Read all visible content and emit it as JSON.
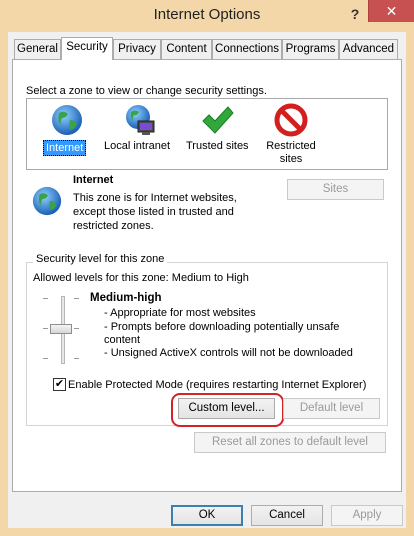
{
  "window": {
    "title": "Internet Options",
    "help_label": "?",
    "close_label": "✕"
  },
  "tabs": [
    "General",
    "Security",
    "Privacy",
    "Content",
    "Connections",
    "Programs",
    "Advanced"
  ],
  "active_tab": "Security",
  "zones_prompt": "Select a zone to view or change security settings.",
  "zones": [
    {
      "label": "Internet",
      "icon": "globe-icon",
      "selected": true
    },
    {
      "label": "Local intranet",
      "icon": "intranet-globe-icon"
    },
    {
      "label": "Trusted sites",
      "icon": "checkmark-icon"
    },
    {
      "label_line1": "Restricted",
      "label_line2": "sites",
      "icon": "restricted-icon"
    }
  ],
  "zone_detail": {
    "title": "Internet",
    "desc": [
      "This zone is for Internet websites,",
      "except those listed in trusted and",
      "restricted zones."
    ],
    "sites_button": "Sites"
  },
  "security_level": {
    "group_label": "Security level for this zone",
    "allowed": "Allowed levels for this zone: Medium to High",
    "level_name": "Medium-high",
    "bullets": [
      "- Appropriate for most websites",
      "- Prompts before downloading potentially unsafe",
      "content",
      "- Unsigned ActiveX controls will not be downloaded"
    ]
  },
  "protected_mode": {
    "label": "Enable Protected Mode (requires restarting Internet Explorer)",
    "checked": true,
    "check_glyph": "✔"
  },
  "buttons": {
    "custom_level": "Custom level...",
    "default_level": "Default level",
    "reset_all": "Reset all zones to default level",
    "ok": "OK",
    "cancel": "Cancel",
    "apply": "Apply"
  },
  "colors": {
    "title_bar": "#f4d7a8",
    "selection": "#3399ff",
    "highlight_ring": "#d0232a",
    "close_button": "#c75050"
  }
}
